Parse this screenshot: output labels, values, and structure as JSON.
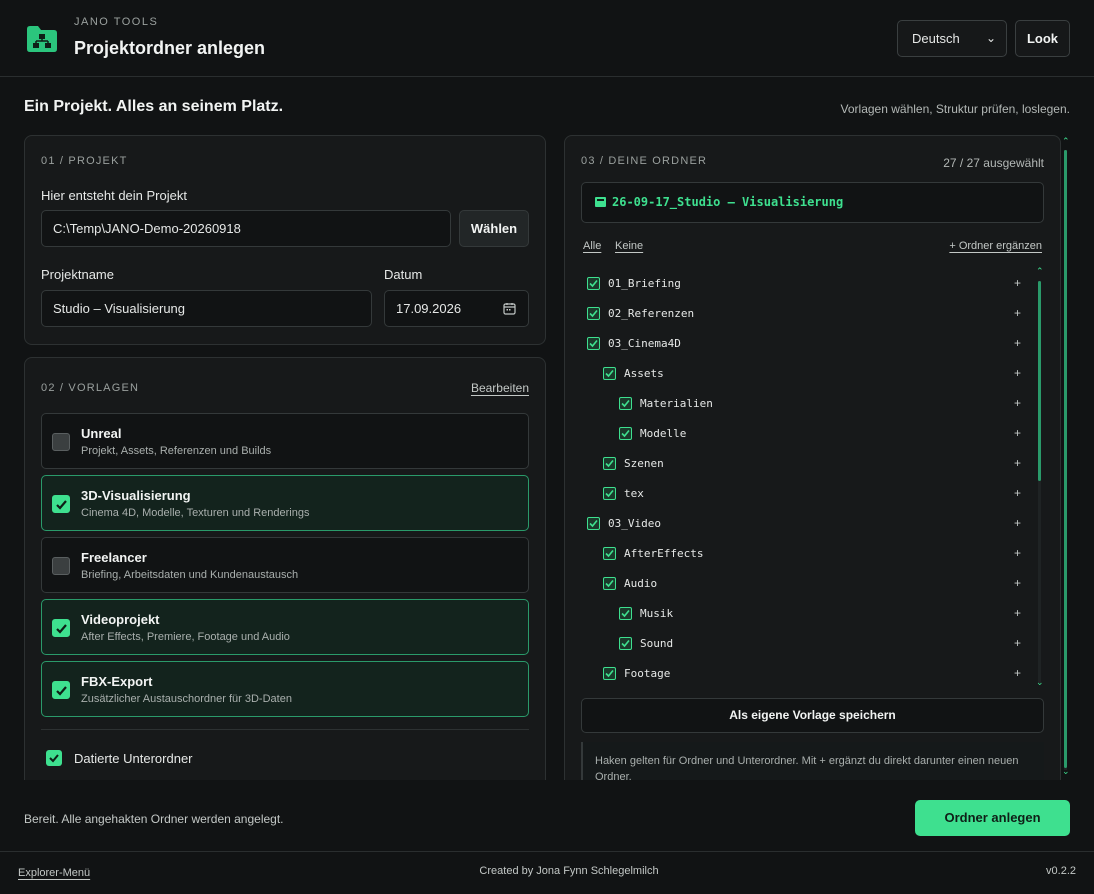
{
  "header": {
    "brand_small": "JANO TOOLS",
    "title": "Projektordner anlegen",
    "language": "Deutsch",
    "look_label": "Look"
  },
  "tagline": {
    "left": "Ein Projekt. Alles an seinem Platz.",
    "right": "Vorlagen wählen, Struktur prüfen, loslegen."
  },
  "project": {
    "section_label": "01 / PROJEKT",
    "path_label": "Hier entsteht dein Projekt",
    "path_value": "C:\\Temp\\JANO-Demo-20260918",
    "choose_label": "Wählen",
    "name_label": "Projektname",
    "name_value": "Studio – Visualisierung",
    "date_label": "Datum",
    "date_value": "17.09.2026"
  },
  "templates": {
    "section_label": "02 / VORLAGEN",
    "edit_label": "Bearbeiten",
    "items": [
      {
        "name": "Unreal",
        "desc": "Projekt, Assets, Referenzen und Builds",
        "checked": false
      },
      {
        "name": "3D-Visualisierung",
        "desc": "Cinema 4D, Modelle, Texturen und Renderings",
        "checked": true
      },
      {
        "name": "Freelancer",
        "desc": "Briefing, Arbeitsdaten und Kundenaustausch",
        "checked": false
      },
      {
        "name": "Videoprojekt",
        "desc": "After Effects, Premiere, Footage und Audio",
        "checked": true
      },
      {
        "name": "FBX-Export",
        "desc": "Zusätzlicher Austauschordner für 3D-Daten",
        "checked": true
      }
    ],
    "dated_label": "Datierte Unterordner"
  },
  "folders": {
    "section_label": "03 / DEINE ORDNER",
    "count": "27 / 27 ausgewählt",
    "root": "26-09-17_Studio – Visualisierung",
    "all_label": "Alle",
    "none_label": "Keine",
    "add_label": "+ Ordner ergänzen",
    "plus": "+",
    "tree": [
      {
        "label": "01_Briefing",
        "depth": 0
      },
      {
        "label": "02_Referenzen",
        "depth": 0
      },
      {
        "label": "03_Cinema4D",
        "depth": 0
      },
      {
        "label": "Assets",
        "depth": 1
      },
      {
        "label": "Materialien",
        "depth": 2
      },
      {
        "label": "Modelle",
        "depth": 2
      },
      {
        "label": "Szenen",
        "depth": 1
      },
      {
        "label": "tex",
        "depth": 1
      },
      {
        "label": "03_Video",
        "depth": 0
      },
      {
        "label": "AfterEffects",
        "depth": 1
      },
      {
        "label": "Audio",
        "depth": 1
      },
      {
        "label": "Musik",
        "depth": 2
      },
      {
        "label": "Sound",
        "depth": 2
      },
      {
        "label": "Footage",
        "depth": 1
      }
    ],
    "save_template_label": "Als eigene Vorlage speichern",
    "hint": "Haken gelten für Ordner und Unterordner. Mit + ergänzt du direkt darunter einen neuen Ordner."
  },
  "action": {
    "status": "Bereit. Alle angehakten Ordner werden angelegt.",
    "create_label": "Ordner anlegen"
  },
  "footer": {
    "menu_label": "Explorer-Menü",
    "credit": "Created by Jona Fynn Schlegelmilch",
    "version": "v0.2.2"
  },
  "colors": {
    "accent": "#3ee08f",
    "background": "#111314",
    "panel": "#17191a"
  }
}
